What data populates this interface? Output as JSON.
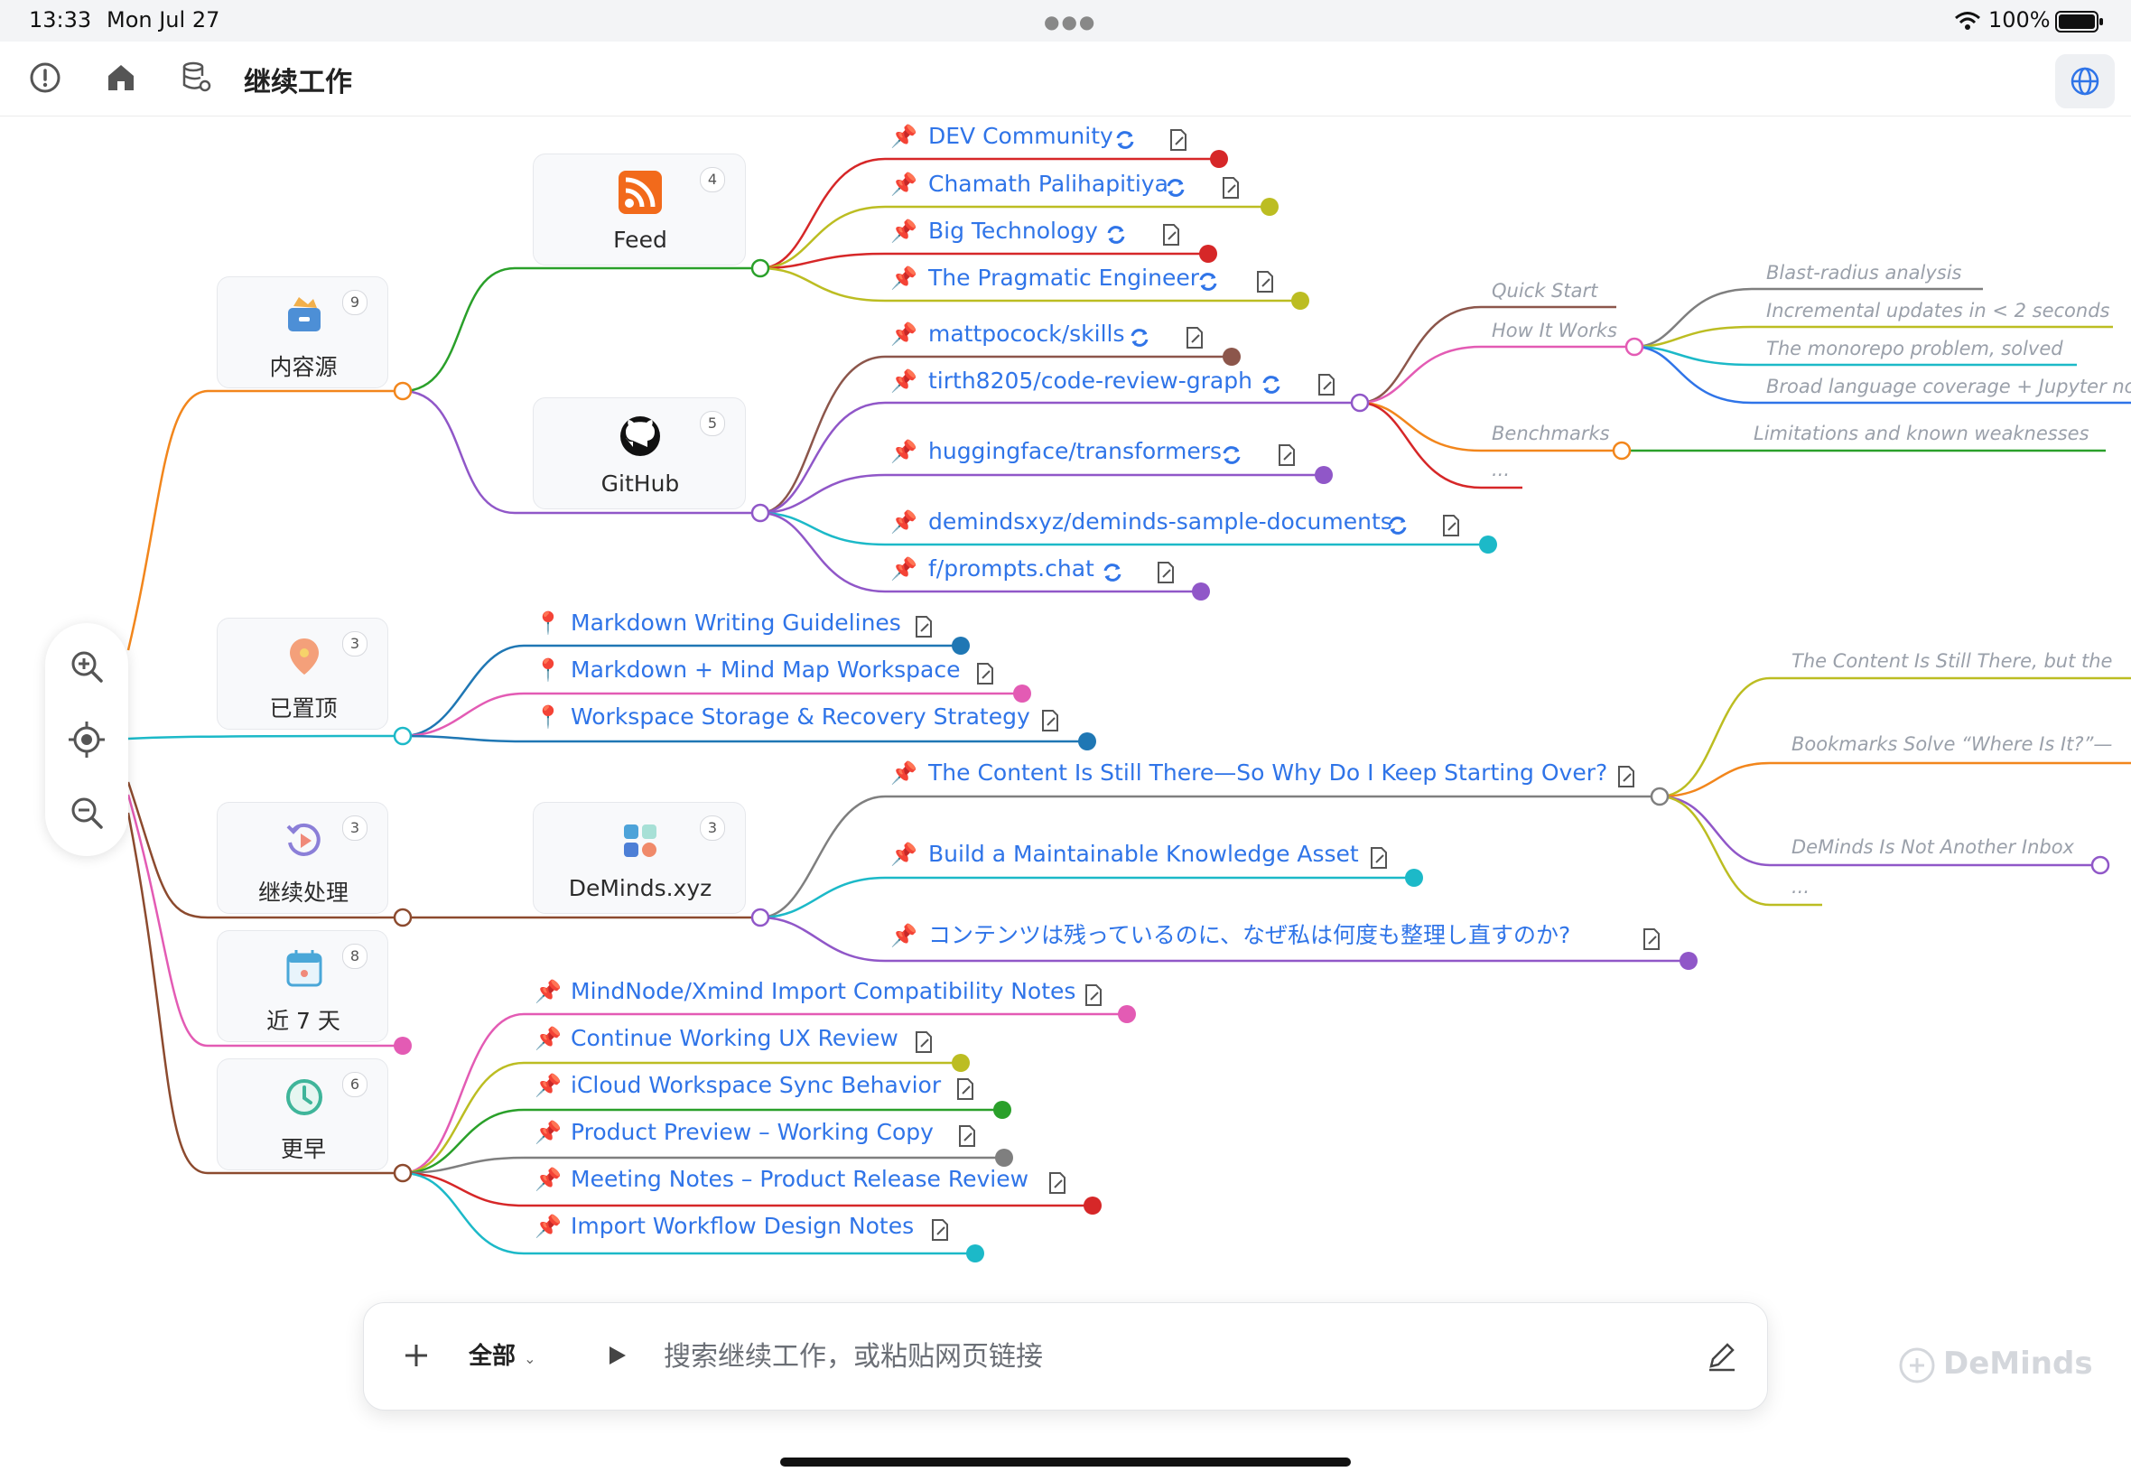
{
  "status_bar": {
    "time": "13:33",
    "date": "Mon Jul 27",
    "battery": "100%"
  },
  "header": {
    "title": "继续工作"
  },
  "categories": {
    "content_sources": {
      "label": "内容源",
      "count": "9"
    },
    "pinned": {
      "label": "已置顶",
      "count": "3"
    },
    "continue": {
      "label": "继续处理",
      "count": "3"
    },
    "last7": {
      "label": "近 7 天",
      "count": "8"
    },
    "earlier": {
      "label": "更早",
      "count": "6"
    }
  },
  "sources": {
    "feed": {
      "label": "Feed",
      "count": "4"
    },
    "github": {
      "label": "GitHub",
      "count": "5"
    },
    "deminds": {
      "label": "DeMinds.xyz",
      "count": "3"
    }
  },
  "feed_items": [
    "DEV Community",
    "Chamath Palihapitiya",
    "Big Technology",
    "The Pragmatic Engineer"
  ],
  "github_items": [
    "mattpocock/skills",
    "tirth8205/code-review-graph",
    "huggingface/transformers",
    "demindsxyz/deminds-sample-documents",
    "f/prompts.chat"
  ],
  "graph_sub": {
    "quick_start": "Quick Start",
    "how_it_works": "How It Works",
    "benchmarks": "Benchmarks",
    "more": "...",
    "how_children": [
      "Blast-radius analysis",
      "Incremental updates in < 2 seconds",
      "The monorepo problem, solved",
      "Broad language coverage + Jupyter no"
    ],
    "limitations": "Limitations and known weaknesses"
  },
  "pinned_items": [
    "Markdown Writing Guidelines",
    "Markdown + Mind Map Workspace",
    "Workspace Storage & Recovery Strategy"
  ],
  "deminds_items": [
    "The Content Is Still There—So Why Do I Keep Starting Over?",
    "Build a Maintainable Knowledge Asset",
    "コンテンツは残っているのに、なぜ私は何度も整理し直すのか?"
  ],
  "content_sub": {
    "item1": "The Content Is Still There, but the",
    "item2": "Bookmarks Solve “Where Is It?”—",
    "item3": "DeMinds Is Not Another Inbox",
    "more": "..."
  },
  "earlier_items": [
    "MindNode/Xmind Import Compatibility Notes",
    "Continue Working UX Review",
    "iCloud Workspace Sync Behavior",
    "Product Preview – Working Copy",
    "Meeting Notes – Product Release Review",
    "Import Workflow Design Notes"
  ],
  "search": {
    "scope": "全部",
    "placeholder": "搜索继续工作，或粘贴网页链接"
  },
  "brand": "DeMinds",
  "colors": {
    "link": "#2f74e8",
    "accent": "#2f74e8",
    "rss": "#f26a1b"
  }
}
